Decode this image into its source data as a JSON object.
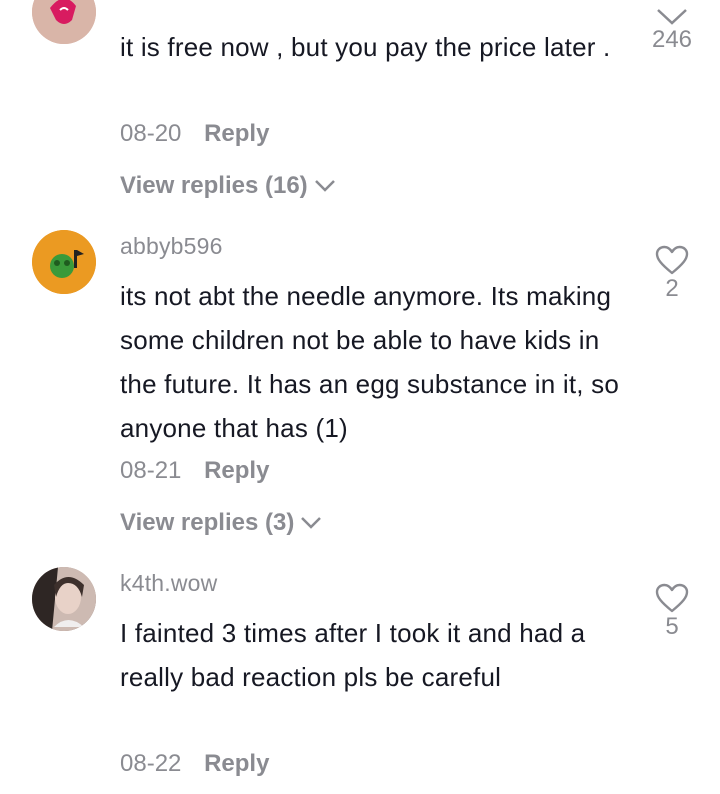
{
  "comments": [
    {
      "username": "",
      "text": "it is free now , but you pay the price later .",
      "date": "08-20",
      "reply_label": "Reply",
      "view_replies": "View replies (16)",
      "likes": "246",
      "avatar_color": "#d9b5a8"
    },
    {
      "username": "abbyb596",
      "text": "its not abt the needle anymore. Its making some children not be able to have kids in the future. It has an egg substance in it, so anyone that has (1)",
      "date": "08-21",
      "reply_label": "Reply",
      "view_replies": "View replies (3)",
      "likes": "2",
      "avatar_color": "#f2b233"
    },
    {
      "username": "k4th.wow",
      "text": "I fainted 3 times after I took it and had a really bad reaction pls be careful",
      "date": "08-22",
      "reply_label": "Reply",
      "view_replies": "",
      "likes": "5",
      "avatar_color": "#6b5a55"
    }
  ],
  "icons": {
    "like": "heart-outline-icon",
    "expand": "chevron-down-icon"
  }
}
